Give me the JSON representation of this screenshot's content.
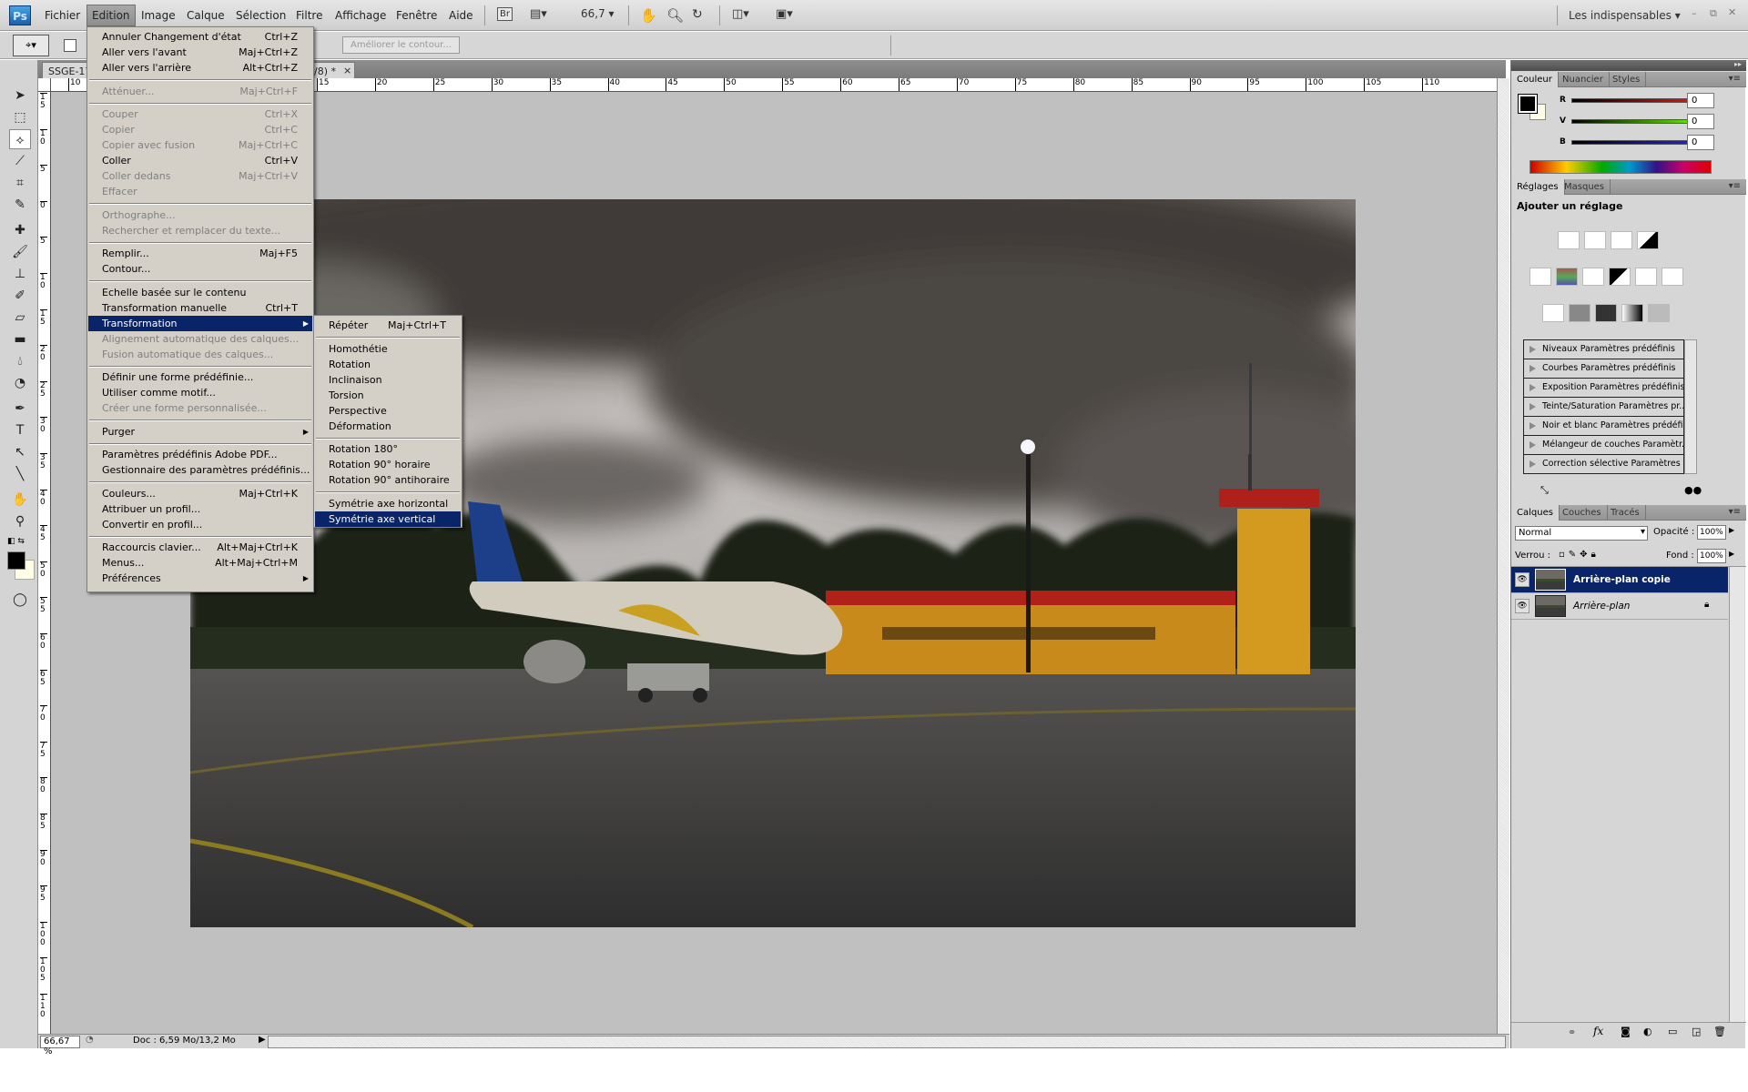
{
  "app": {
    "logo": "Ps",
    "workspace": "Les indispensables",
    "window_controls": [
      "minimize",
      "restore",
      "close"
    ]
  },
  "menubar": {
    "items": [
      "Fichier",
      "Edition",
      "Image",
      "Calque",
      "Sélection",
      "Filtre",
      "Affichage",
      "Fenêtre",
      "Aide"
    ],
    "active": "Edition",
    "bridge_label": "Br",
    "zoom_value": "66,7",
    "icons": [
      "bridge-icon",
      "screen-layout-icon",
      "hand-icon",
      "zoom-icon",
      "rotate-view-icon",
      "arrange-documents-icon",
      "screen-mode-icon"
    ]
  },
  "options_bar": {
    "refine_edge_label": "Améliorer le contour..."
  },
  "document": {
    "tab_title_start": "SSGE-17",
    "tab_title_end": "/8) *",
    "close": "×"
  },
  "rulers": {
    "top": [
      "10",
      "15",
      "20",
      "25",
      "30",
      "35",
      "40",
      "45",
      "50",
      "55",
      "60",
      "65",
      "70",
      "75",
      "80",
      "85",
      "90",
      "95",
      "100",
      "105",
      "110"
    ],
    "left": [
      "15",
      "10",
      "5",
      "0",
      "5",
      "10",
      "15",
      "20",
      "25",
      "30",
      "35",
      "40",
      "45",
      "50",
      "55",
      "60",
      "65",
      "70",
      "75",
      "80",
      "85",
      "90",
      "95",
      "100",
      "105",
      "110"
    ]
  },
  "status": {
    "zoom": "66,67 %",
    "doc_info": "Doc : 6,59 Mo/13,2 Mo"
  },
  "edit_menu": [
    {
      "label": "Annuler Changement d'état",
      "shortcut": "Ctrl+Z"
    },
    {
      "label": "Aller vers l'avant",
      "shortcut": "Maj+Ctrl+Z"
    },
    {
      "label": "Aller vers l'arrière",
      "shortcut": "Alt+Ctrl+Z"
    },
    {
      "sep": true
    },
    {
      "label": "Atténuer...",
      "shortcut": "Maj+Ctrl+F",
      "disabled": true
    },
    {
      "sep": true
    },
    {
      "label": "Couper",
      "shortcut": "Ctrl+X",
      "disabled": true
    },
    {
      "label": "Copier",
      "shortcut": "Ctrl+C",
      "disabled": true
    },
    {
      "label": "Copier avec fusion",
      "shortcut": "Maj+Ctrl+C",
      "disabled": true
    },
    {
      "label": "Coller",
      "shortcut": "Ctrl+V"
    },
    {
      "label": "Coller dedans",
      "shortcut": "Maj+Ctrl+V",
      "disabled": true
    },
    {
      "label": "Effacer",
      "disabled": true
    },
    {
      "sep": true
    },
    {
      "label": "Orthographe...",
      "disabled": true
    },
    {
      "label": "Rechercher et remplacer du texte...",
      "disabled": true
    },
    {
      "sep": true
    },
    {
      "label": "Remplir...",
      "shortcut": "Maj+F5"
    },
    {
      "label": "Contour..."
    },
    {
      "sep": true
    },
    {
      "label": "Echelle basée sur le contenu"
    },
    {
      "label": "Transformation manuelle",
      "shortcut": "Ctrl+T"
    },
    {
      "label": "Transformation",
      "submenu": true,
      "highlighted": true
    },
    {
      "label": "Alignement automatique des calques...",
      "disabled": true
    },
    {
      "label": "Fusion automatique des calques...",
      "disabled": true
    },
    {
      "sep": true
    },
    {
      "label": "Définir une forme prédéfinie..."
    },
    {
      "label": "Utiliser comme motif..."
    },
    {
      "label": "Créer une forme personnalisée...",
      "disabled": true
    },
    {
      "sep": true
    },
    {
      "label": "Purger",
      "submenu": true
    },
    {
      "sep": true
    },
    {
      "label": "Paramètres prédéfinis Adobe PDF..."
    },
    {
      "label": "Gestionnaire des paramètres prédéfinis..."
    },
    {
      "sep": true
    },
    {
      "label": "Couleurs...",
      "shortcut": "Maj+Ctrl+K"
    },
    {
      "label": "Attribuer un profil..."
    },
    {
      "label": "Convertir en profil..."
    },
    {
      "sep": true
    },
    {
      "label": "Raccourcis clavier...",
      "shortcut": "Alt+Maj+Ctrl+K"
    },
    {
      "label": "Menus...",
      "shortcut": "Alt+Maj+Ctrl+M"
    },
    {
      "label": "Préférences",
      "submenu": true
    }
  ],
  "transform_submenu": [
    {
      "label": "Répéter",
      "shortcut": "Maj+Ctrl+T"
    },
    {
      "sep": true
    },
    {
      "label": "Homothétie"
    },
    {
      "label": "Rotation"
    },
    {
      "label": "Inclinaison"
    },
    {
      "label": "Torsion"
    },
    {
      "label": "Perspective"
    },
    {
      "label": "Déformation"
    },
    {
      "sep": true
    },
    {
      "label": "Rotation 180°"
    },
    {
      "label": "Rotation 90° horaire"
    },
    {
      "label": "Rotation 90° antihoraire"
    },
    {
      "sep": true
    },
    {
      "label": "Symétrie axe horizontal"
    },
    {
      "label": "Symétrie axe vertical",
      "highlighted": true
    }
  ],
  "color_panel": {
    "tabs": [
      "Couleur",
      "Nuancier",
      "Styles"
    ],
    "channels": [
      {
        "label": "R",
        "value": "0",
        "color": "#e01010"
      },
      {
        "label": "V",
        "value": "0",
        "color": "#60e000"
      },
      {
        "label": "B",
        "value": "0",
        "color": "#2020e0"
      }
    ],
    "foreground": "#000000",
    "background": "#fffde6"
  },
  "adjustments_panel": {
    "tabs": [
      "Réglages",
      "Masques"
    ],
    "title": "Ajouter un réglage",
    "presets": [
      "Niveaux Paramètres prédéfinis",
      "Courbes Paramètres prédéfinis",
      "Exposition Paramètres prédéfinis",
      "Teinte/Saturation Paramètres pr...",
      "Noir et blanc Paramètres prédéfi...",
      "Mélangeur de couches Paramètr...",
      "Correction sélective Paramètres ..."
    ]
  },
  "layers_panel": {
    "tabs": [
      "Calques",
      "Couches",
      "Tracés"
    ],
    "blend_mode": "Normal",
    "opacity_label": "Opacité :",
    "opacity": "100%",
    "lock_label": "Verrou :",
    "fill_label": "Fond :",
    "fill": "100%",
    "layers": [
      {
        "name": "Arrière-plan copie",
        "selected": true
      },
      {
        "name": "Arrière-plan",
        "locked": true
      }
    ]
  },
  "colors": {
    "menu_highlight": "#0a246a",
    "canvas_bg": "#c0c0c0"
  }
}
